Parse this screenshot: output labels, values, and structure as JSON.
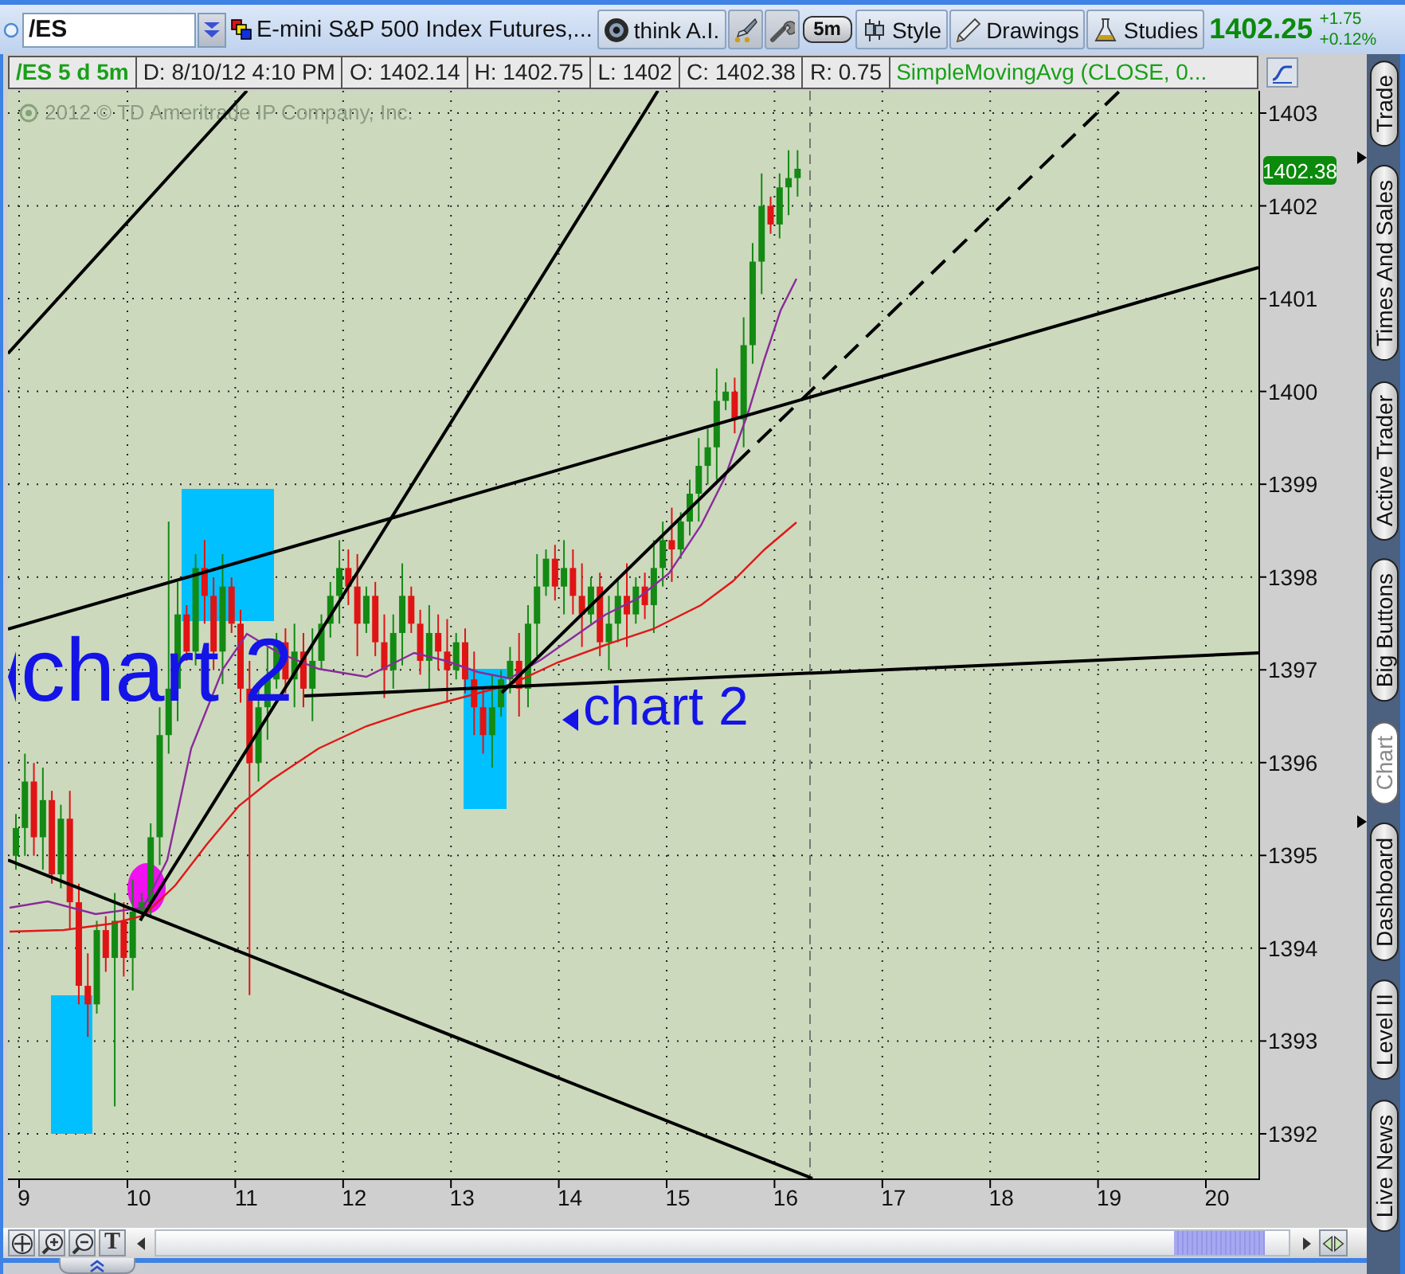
{
  "toolbar": {
    "symbol": "/ES",
    "description": "E-mini S&P 500 Index Futures,...",
    "think_button": "think A.I.",
    "aggregation": "5m",
    "style_button": "Style",
    "drawings_button": "Drawings",
    "studies_button": "Studies",
    "last_price": "1402.25",
    "net_change": "+1.75",
    "percent_change": "+0.12%"
  },
  "info_bar": [
    {
      "kind": "symbol",
      "text": "/ES 5 d 5m"
    },
    {
      "kind": "value",
      "text": "D: 8/10/12 4:10 PM"
    },
    {
      "kind": "value",
      "text": "O: 1402.14"
    },
    {
      "kind": "value",
      "text": "H: 1402.75"
    },
    {
      "kind": "value",
      "text": "L: 1402"
    },
    {
      "kind": "value",
      "text": "C: 1402.38"
    },
    {
      "kind": "value",
      "text": "R: 0.75"
    },
    {
      "kind": "study",
      "text": "SimpleMovingAvg (CLOSE, 0..."
    }
  ],
  "chart": {
    "watermark": "2012 © TD Ameritrade IP Company, Inc.",
    "price_axis": [
      "1403",
      "1402",
      "1401",
      "1400",
      "1399",
      "1398",
      "1397",
      "1396",
      "1395",
      "1394",
      "1393",
      "1392"
    ],
    "last_price_tag": "1402.38",
    "time_axis": [
      "9",
      "10",
      "11",
      "12",
      "13",
      "14",
      "15",
      "16",
      "17",
      "18",
      "19",
      "20"
    ],
    "annotations": [
      {
        "kind": "large",
        "text": "chart 2"
      },
      {
        "kind": "small",
        "text": "chart 2"
      }
    ]
  },
  "bottom_bar": {
    "text_tool": "T"
  },
  "side_tabs": [
    {
      "label": "Trade",
      "selected": false
    },
    {
      "label": "Times And Sales",
      "selected": false
    },
    {
      "label": "Active Trader",
      "selected": false
    },
    {
      "label": "Big Buttons",
      "selected": false
    },
    {
      "label": "Chart",
      "selected": true
    },
    {
      "label": "Dashboard",
      "selected": false
    },
    {
      "label": "Level II",
      "selected": false
    },
    {
      "label": "Live News",
      "selected": false
    }
  ]
}
